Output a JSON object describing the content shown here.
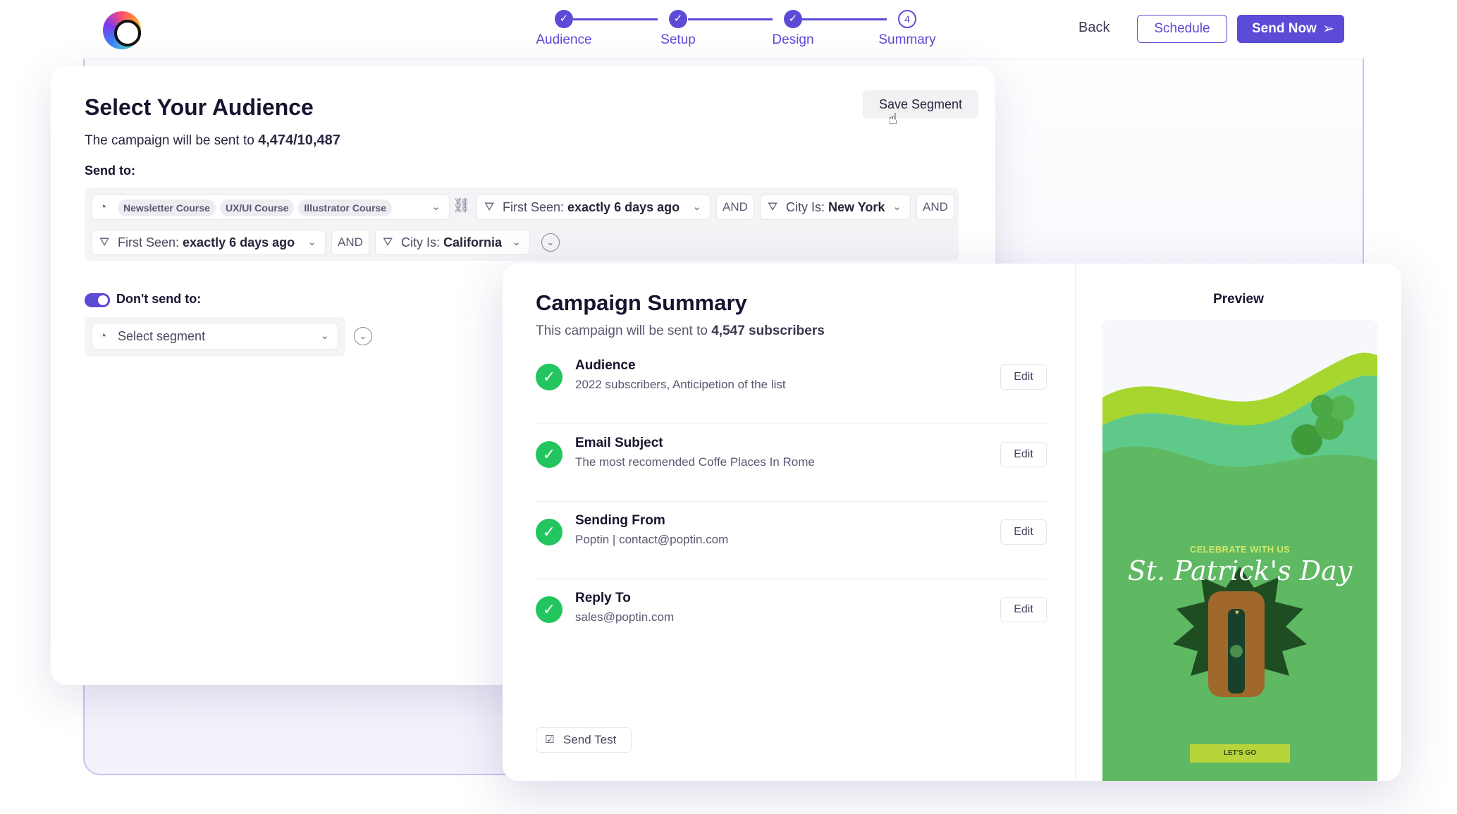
{
  "header": {
    "steps": [
      {
        "label": "Audience",
        "state": "done",
        "marker": "✓"
      },
      {
        "label": "Setup",
        "state": "done",
        "marker": "✓"
      },
      {
        "label": "Design",
        "state": "done",
        "marker": "✓"
      },
      {
        "label": "Summary",
        "state": "current",
        "marker": "4"
      }
    ],
    "back_label": "Back",
    "schedule_label": "Schedule",
    "send_now_label": "Send Now",
    "accent_color": "#5b4bd6"
  },
  "audience": {
    "title": "Select Your Audience",
    "subtitle_prefix": "The campaign will be sent to ",
    "subtitle_count": "4,474/10,487",
    "save_segment_label": "Save Segment",
    "send_to_label": "Send to:",
    "segment_tags": [
      "Newsletter Course",
      "UX/UI Course",
      "Illustrator Course"
    ],
    "filters": [
      {
        "prefix": "First Seen: ",
        "value": "exactly 6 days ago"
      },
      {
        "prefix": "City Is: ",
        "value": "New York"
      },
      {
        "prefix": "First Seen: ",
        "value": "exactly 6 days ago"
      },
      {
        "prefix": "City Is: ",
        "value": "California"
      }
    ],
    "and_label": "AND",
    "dont_send_label": "Don't send to:",
    "dont_send_enabled": true,
    "segment_placeholder": "Select segment"
  },
  "summary": {
    "title": "Campaign Summary",
    "subtitle_prefix": "This campaign will be sent to ",
    "subtitle_count": "4,547 subscribers",
    "rows": [
      {
        "title": "Audience",
        "detail": "2022 subscribers, Anticipetion of the list"
      },
      {
        "title": "Email Subject",
        "detail": "The most recomended Coffe Places In Rome"
      },
      {
        "title": "Sending From",
        "detail": "Poptin | contact@poptin.com"
      },
      {
        "title": "Reply To",
        "detail": "sales@poptin.com"
      }
    ],
    "edit_label": "Edit",
    "send_test_label": "Send Test",
    "success_color": "#22c55e"
  },
  "preview": {
    "label": "Preview",
    "kicker": "CELEBRATE WITH US",
    "headline": "St. Patrick's Day",
    "cta": "LET'S GO"
  }
}
